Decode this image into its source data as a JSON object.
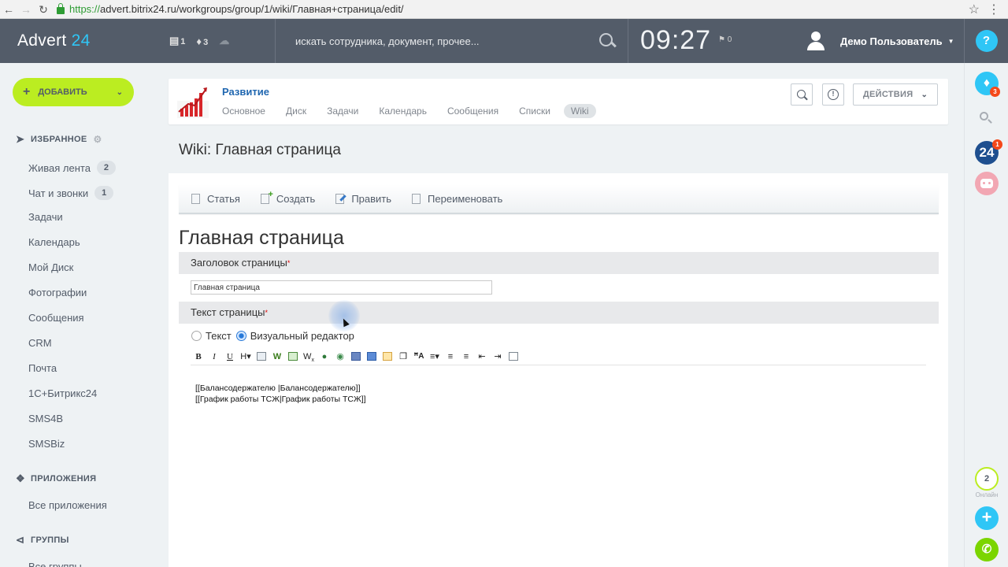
{
  "browser": {
    "url_scheme": "https://",
    "url_rest": "advert.bitrix24.ru/workgroups/group/1/wiki/Главная+страница/edit/"
  },
  "header": {
    "logo_text": "Advert",
    "logo_num": "24",
    "messages_count": "1",
    "notifications_count": "3",
    "search_placeholder": "искать сотрудника, документ, прочее...",
    "clock": "09:27",
    "flag_count": "0",
    "user_name": "Демо Пользователь",
    "help_label": "?"
  },
  "sidebar": {
    "add_label": "ДОБАВИТЬ",
    "favorites_title": "ИЗБРАННОЕ",
    "items": [
      {
        "label": "Живая лента",
        "badge": "2"
      },
      {
        "label": "Чат и звонки",
        "badge": "1"
      },
      {
        "label": "Задачи"
      },
      {
        "label": "Календарь"
      },
      {
        "label": "Мой Диск"
      },
      {
        "label": "Фотографии"
      },
      {
        "label": "Сообщения"
      },
      {
        "label": "CRM"
      },
      {
        "label": "Почта"
      },
      {
        "label": "1С+Битрикс24"
      },
      {
        "label": "SMS4B"
      },
      {
        "label": "SMSBiz"
      }
    ],
    "apps_title": "ПРИЛОЖЕНИЯ",
    "apps_items": [
      {
        "label": "Все приложения"
      }
    ],
    "groups_title": "ГРУППЫ",
    "groups_items": [
      {
        "label": "Все группы"
      }
    ]
  },
  "right_bar": {
    "notif_badge": "3",
    "b24_label": "24",
    "b24_badge": "1",
    "online_count": "2",
    "online_label": "Онлайн",
    "plus_label": "+"
  },
  "group": {
    "title": "Развитие",
    "tabs": [
      "Основное",
      "Диск",
      "Задачи",
      "Календарь",
      "Сообщения",
      "Списки",
      "Wiki"
    ],
    "active_tab": "Wiki",
    "actions_label": "ДЕЙСТВИЯ"
  },
  "page": {
    "title": "Wiki: Главная страница",
    "toolbar": [
      "Статья",
      "Создать",
      "Править",
      "Переименовать"
    ],
    "heading": "Главная страница",
    "title_field_label": "Заголовок страницы",
    "title_field_value": "Главная страница",
    "text_field_label": "Текст страницы",
    "mode_text": "Текст",
    "mode_visual": "Визуальный редактор",
    "editor_lines": [
      "[[Балансодержателю |Балансодержателю]]",
      "[[График работы ТСЖ|График работы ТСЖ]]"
    ]
  },
  "colors": {
    "header_bg": "#535c69",
    "accent_blue": "#2fc6f6",
    "add_green": "#bbed21",
    "link_blue": "#2067b0"
  }
}
